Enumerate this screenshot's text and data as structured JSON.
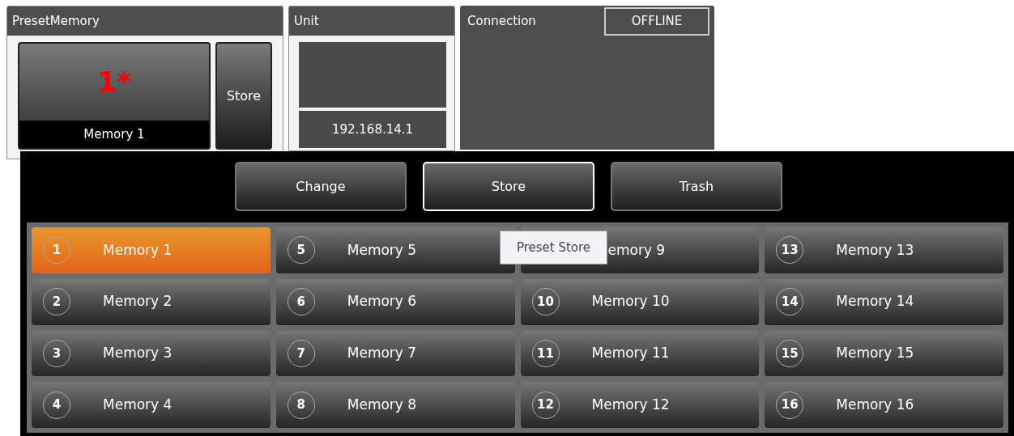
{
  "preset_memory": {
    "title": "PresetMemory",
    "current": {
      "number": "1*",
      "label": "Memory 1"
    },
    "store_button": "Store"
  },
  "unit": {
    "title": "Unit",
    "address": "192.168.14.1"
  },
  "connection": {
    "title": "Connection",
    "status": "OFFLINE"
  },
  "actions": [
    {
      "label": "Change",
      "selected": false
    },
    {
      "label": "Store",
      "selected": true
    },
    {
      "label": "Trash",
      "selected": false
    }
  ],
  "memories": [
    {
      "number": "1",
      "label": "Memory 1",
      "selected": true
    },
    {
      "number": "5",
      "label": "Memory 5",
      "selected": false
    },
    {
      "label": "emory 9",
      "selected": false
    },
    {
      "number": "13",
      "label": "Memory 13",
      "selected": false
    },
    {
      "number": "2",
      "label": "Memory 2",
      "selected": false
    },
    {
      "number": "6",
      "label": "Memory 6",
      "selected": false
    },
    {
      "number": "10",
      "label": "Memory 10",
      "selected": false
    },
    {
      "number": "14",
      "label": "Memory 14",
      "selected": false
    },
    {
      "number": "3",
      "label": "Memory 3",
      "selected": false
    },
    {
      "number": "7",
      "label": "Memory 7",
      "selected": false
    },
    {
      "number": "11",
      "label": "Memory 11",
      "selected": false
    },
    {
      "number": "15",
      "label": "Memory 15",
      "selected": false
    },
    {
      "number": "4",
      "label": "Memory 4",
      "selected": false
    },
    {
      "number": "8",
      "label": "Memory 8",
      "selected": false
    },
    {
      "number": "12",
      "label": "Memory 12",
      "selected": false
    },
    {
      "number": "16",
      "label": "Memory 16",
      "selected": false
    }
  ],
  "tooltip": "Preset Store"
}
